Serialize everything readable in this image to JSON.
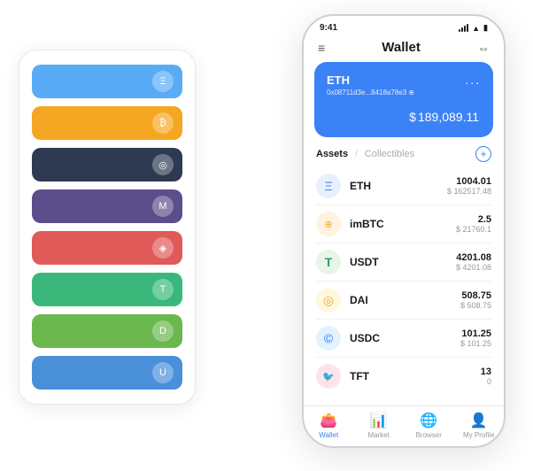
{
  "scene": {
    "cardStack": {
      "cards": [
        {
          "id": "card-1",
          "color": "card-1",
          "iconText": "Ξ"
        },
        {
          "id": "card-2",
          "color": "card-2",
          "iconText": "₿"
        },
        {
          "id": "card-3",
          "color": "card-3",
          "iconText": "◎"
        },
        {
          "id": "card-4",
          "color": "card-4",
          "iconText": "M"
        },
        {
          "id": "card-5",
          "color": "card-5",
          "iconText": "◈"
        },
        {
          "id": "card-6",
          "color": "card-6",
          "iconText": "T"
        },
        {
          "id": "card-7",
          "color": "card-7",
          "iconText": "D"
        },
        {
          "id": "card-8",
          "color": "card-8",
          "iconText": "U"
        }
      ]
    },
    "phone": {
      "statusBar": {
        "time": "9:41"
      },
      "header": {
        "menuIcon": "≡",
        "title": "Wallet",
        "expandIcon": "⇔"
      },
      "ethCard": {
        "label": "ETH",
        "address": "0x08711d3e...8418a78e3",
        "addressSuffix": "⊕",
        "dotsLabel": "...",
        "balancePrefix": "$",
        "balance": "189,089.11"
      },
      "assetsSection": {
        "tabActive": "Assets",
        "tabDivider": "/",
        "tabInactive": "Collectibles",
        "addButtonLabel": "+"
      },
      "assets": [
        {
          "name": "ETH",
          "icon": "Ξ",
          "iconBg": "#e8f0fe",
          "iconColor": "#3b82f6",
          "amount": "1004.01",
          "usd": "$ 162517.48"
        },
        {
          "name": "imBTC",
          "icon": "⊕",
          "iconBg": "#fff3e0",
          "iconColor": "#f5a623",
          "amount": "2.5",
          "usd": "$ 21760.1"
        },
        {
          "name": "USDT",
          "icon": "T",
          "iconBg": "#e8f5e9",
          "iconColor": "#26a17b",
          "amount": "4201.08",
          "usd": "$ 4201.08"
        },
        {
          "name": "DAI",
          "icon": "◎",
          "iconBg": "#fff8e1",
          "iconColor": "#f5a623",
          "amount": "508.75",
          "usd": "$ 508.75"
        },
        {
          "name": "USDC",
          "icon": "©",
          "iconBg": "#e3f2fd",
          "iconColor": "#2979ff",
          "amount": "101.25",
          "usd": "$ 101.25"
        },
        {
          "name": "TFT",
          "icon": "🐦",
          "iconBg": "#fce4ec",
          "iconColor": "#e91e63",
          "amount": "13",
          "usd": "0"
        }
      ],
      "bottomNav": [
        {
          "id": "wallet",
          "icon": "👛",
          "label": "Wallet",
          "active": true
        },
        {
          "id": "market",
          "icon": "📈",
          "label": "Market",
          "active": false
        },
        {
          "id": "browser",
          "icon": "🌐",
          "label": "Browser",
          "active": false
        },
        {
          "id": "profile",
          "icon": "👤",
          "label": "My Profile",
          "active": false
        }
      ]
    }
  }
}
